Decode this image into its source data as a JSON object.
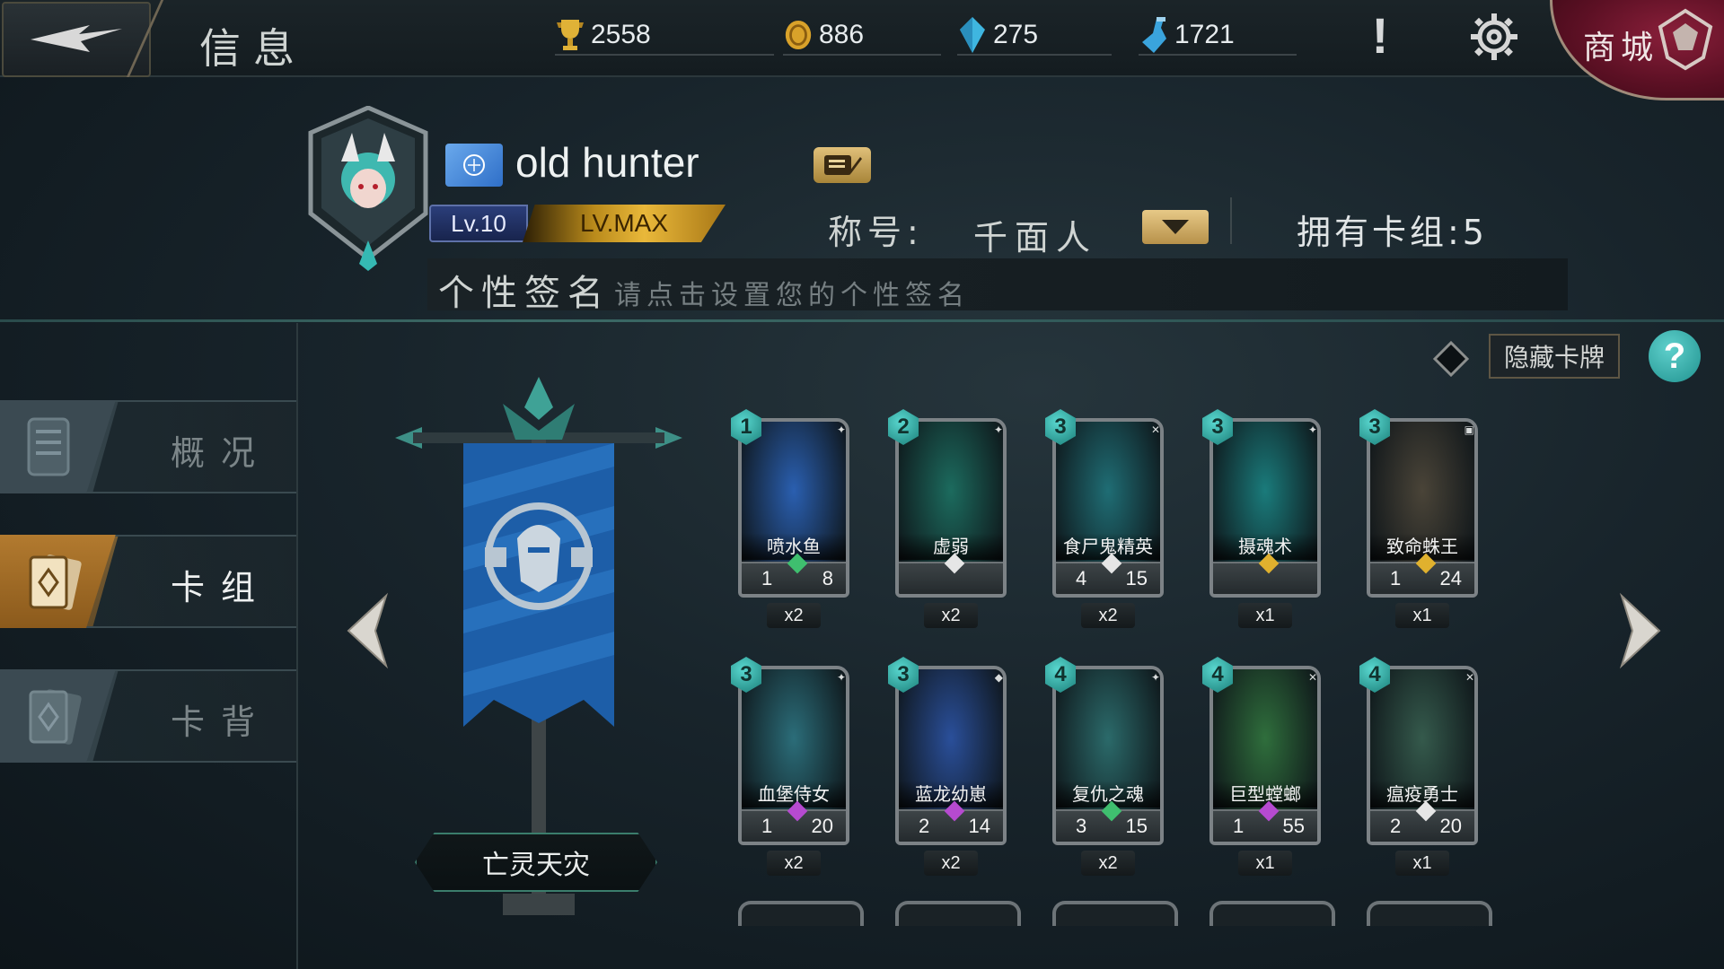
{
  "header": {
    "title": "信息",
    "currencies": [
      {
        "name": "trophy",
        "icon": "trophy-icon",
        "value": "2558"
      },
      {
        "name": "gold",
        "icon": "gold-coin-icon",
        "value": "886"
      },
      {
        "name": "crystal",
        "icon": "crystal-icon",
        "value": "275"
      },
      {
        "name": "dust",
        "icon": "potion-icon",
        "value": "1721"
      }
    ],
    "shop_label": "商城"
  },
  "profile": {
    "name": "old hunter",
    "level": "Lv.10",
    "level_max": "LV.MAX",
    "title_label": "称号:",
    "title_value": "千面人",
    "decks_owned": "拥有卡组:5",
    "signature_label": "个性签名",
    "signature_placeholder": "请点击设置您的个性签名"
  },
  "nav": {
    "tabs": [
      {
        "label": "概况",
        "active": false
      },
      {
        "label": "卡组",
        "active": true
      },
      {
        "label": "卡背",
        "active": false
      }
    ]
  },
  "deck": {
    "name": "亡灵天灾",
    "hide_cards_label": "隐藏卡牌",
    "cards": [
      {
        "cost": "1",
        "name": "喷水鱼",
        "attack": "1",
        "health": "8",
        "count": "x2",
        "gem": "#3fbf6f",
        "art": "#2a5fb0"
      },
      {
        "cost": "2",
        "name": "虚弱",
        "attack": "",
        "health": "",
        "count": "x2",
        "gem": "#e6e6e6",
        "art": "#1c6b5e"
      },
      {
        "cost": "3",
        "name": "食尸鬼精英",
        "attack": "4",
        "health": "15",
        "count": "x2",
        "gem": "#e6e6e6",
        "art": "#1f6d74"
      },
      {
        "cost": "3",
        "name": "摄魂术",
        "attack": "",
        "health": "",
        "count": "x1",
        "gem": "#e0b12e",
        "art": "#1a7b7b"
      },
      {
        "cost": "3",
        "name": "致命蛛王",
        "attack": "1",
        "health": "24",
        "count": "x1",
        "gem": "#e0b12e",
        "art": "#4a4438"
      },
      {
        "cost": "3",
        "name": "血堡侍女",
        "attack": "1",
        "health": "20",
        "count": "x2",
        "gem": "#b64ad0",
        "art": "#2b6d79"
      },
      {
        "cost": "3",
        "name": "蓝龙幼崽",
        "attack": "2",
        "health": "14",
        "count": "x2",
        "gem": "#b64ad0",
        "art": "#2a4f9a"
      },
      {
        "cost": "4",
        "name": "复仇之魂",
        "attack": "3",
        "health": "15",
        "count": "x2",
        "gem": "#3fbf6f",
        "art": "#2b6a6a"
      },
      {
        "cost": "4",
        "name": "巨型螳螂",
        "attack": "1",
        "health": "55",
        "count": "x1",
        "gem": "#b64ad0",
        "art": "#2f6e3c"
      },
      {
        "cost": "4",
        "name": "瘟疫勇士",
        "attack": "2",
        "health": "20",
        "count": "x1",
        "gem": "#e6e6e6",
        "art": "#355a4c"
      }
    ]
  },
  "colors": {
    "accent_teal": "#2fa9a3",
    "gold": "#d9a83a",
    "shop_red": "#7a1832"
  }
}
